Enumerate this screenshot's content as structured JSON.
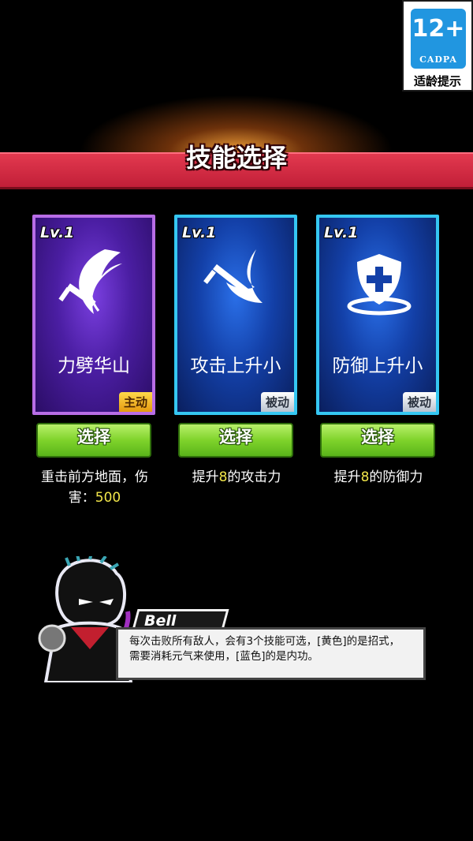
{
  "rating": {
    "age": "12+",
    "org": "CADPA",
    "tip": "适龄提示"
  },
  "header": {
    "title": "技能选择"
  },
  "cards": [
    {
      "level": "Lv.1",
      "name": "力劈华山",
      "tag": "主动",
      "button": "选择",
      "desc_line1": "重击前方地面，伤",
      "desc_prefix": "害：",
      "desc_value": "500"
    },
    {
      "level": "Lv.1",
      "name": "攻击上升小",
      "tag": "被动",
      "button": "选择",
      "desc_prefix": "提升",
      "desc_value": "8",
      "desc_suffix": "的攻击力"
    },
    {
      "level": "Lv.1",
      "name": "防御上升小",
      "tag": "被动",
      "button": "选择",
      "desc_prefix": "提升",
      "desc_value": "8",
      "desc_suffix": "的防御力"
    }
  ],
  "dialog": {
    "speaker": "Bell",
    "text": "每次击败所有敌人，会有3个技能可选，[黄色]的是招式，需要消耗元气来使用，[蓝色]的是内功。"
  },
  "icons": [
    "sword-slash-icon",
    "sword-slash-icon",
    "shield-plus-icon"
  ],
  "colors": {
    "banner": "#d42a44",
    "button": "#7fd32b",
    "highlight": "#f2e64a",
    "purple_frame": "#b86de6",
    "blue_frame": "#35c7f2"
  }
}
